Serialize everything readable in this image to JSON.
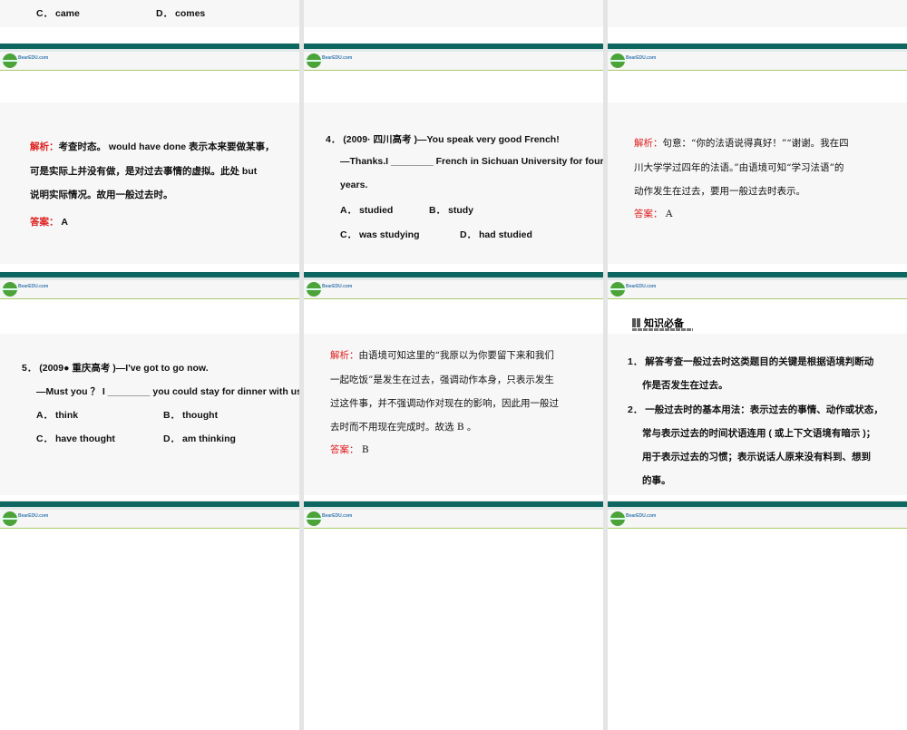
{
  "logo": {
    "text": "BearEDU.com",
    "sub": "■ ■ ■ ■ ■"
  },
  "s0": {
    "c": "C． came",
    "d": "D． comes"
  },
  "s1": {
    "label": "解析：",
    "l1": "考查时态。 would have done 表示本来要做某事，",
    "l2": "可是实际上并没有做，是对过去事情的虚拟。此处 but",
    "l3": "说明实际情况。故用一般过去时。",
    "ans_label": "答案：",
    "ans": "A"
  },
  "s2": {
    "q1": "4． (2009· 四川高考 )—You speak very good French!",
    "q2": "—Thanks.I ________ French in Sichuan University for four",
    "q3": "years.",
    "a": "A． studied",
    "b": "B． study",
    "c": "C． was studying",
    "d": "D． had studied"
  },
  "s3": {
    "label": "解析：",
    "l1": "句意：“你的法语说得真好！”“谢谢。我在四",
    "l2": "川大学学过四年的法语。”由语境可知“学习法语”的",
    "l3": "动作发生在过去，要用一般过去时表示。",
    "ans_label": "答案：",
    "ans": "A"
  },
  "s4": {
    "q1": "5． (2009● 重庆高考 )—I've got to go now.",
    "q2": "—Must you ？ I ________ you could stay for dinner with us.",
    "a": "A． think",
    "b": "B． thought",
    "c": "C． have thought",
    "d": "D． am thinking"
  },
  "s5": {
    "label": "解析：",
    "l1": "由语境可知这里的“我原以为你要留下来和我们",
    "l2": "一起吃饭”是发生在过去，强调动作本身，只表示发生",
    "l3": "过这件事，并不强调动作对现在的影响，因此用一般过",
    "l4": "去时而不用现在完成时。故选 B 。",
    "ans_label": "答案：",
    "ans": "B"
  },
  "s6": {
    "heading": "知识必备",
    "p1a": "1． 解答考查一般过去时这类题目的关键是根据语境判断动",
    "p1b": "作是否发生在过去。",
    "p2a": "2． 一般过去时的基本用法：表示过去的事情、动作或状态，",
    "p2b": "常与表示过去的时间状语连用 ( 或上下文语境有暗示 )；",
    "p2c": "用于表示过去的习惯；表示说话人原来没有料到、想到",
    "p2d": "的事。"
  }
}
